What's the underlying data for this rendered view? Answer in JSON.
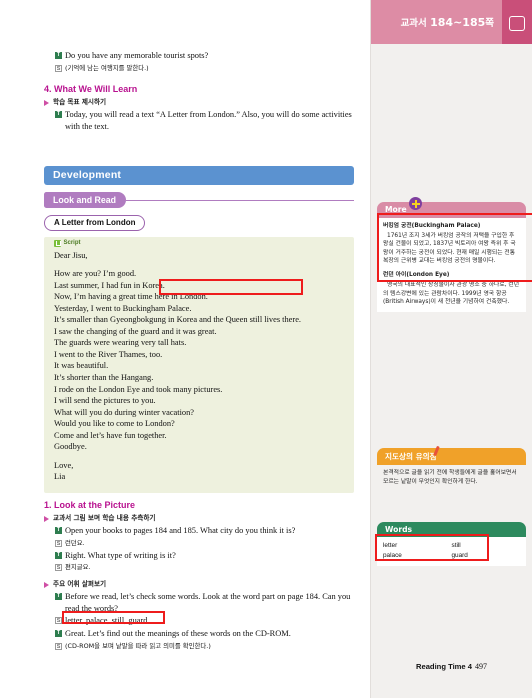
{
  "document": {
    "left_spine_color": "#f3eec4"
  },
  "main": {
    "intro_exchange": [
      {
        "speaker": "T",
        "text": "Do you have any memorable tourist spots?",
        "lang": "en"
      },
      {
        "speaker": "S",
        "text": "(기억에 남는 여행지를 말한다.)",
        "lang": "ko"
      }
    ],
    "section_4": {
      "heading": "4. What We Will Learn",
      "bullet": "학습 목표 제시하기",
      "exchange": [
        {
          "speaker": "T",
          "text": "Today, you will read a text “A Letter from London.” Also, you will do some activities with the text.",
          "lang": "en"
        }
      ]
    },
    "development_bar": "Development",
    "look_and_read": "Look and Read",
    "reading_title": "A Letter from London",
    "script_label": "Script",
    "letter": {
      "salutation": "Dear Jisu,",
      "body": [
        "How are you? I’m good.",
        "Last summer, I had fun in Korea.",
        "Now, I’m having a great time here in London.",
        "Yesterday, I went to Buckingham Palace.",
        "It’s smaller than Gyeongbokgung in Korea and the Queen still lives there.",
        "I saw the changing of the guard and it was great.",
        "The guards were wearing very tall hats.",
        "I went to the River Thames, too.",
        "It was beautiful.",
        "It’s shorter than the Hangang.",
        "I rode on the London Eye and took many pictures.",
        "I will send the pictures to you.",
        "What will you do during winter vacation?",
        "Would you like to come to London?",
        "Come and let’s have fun together.",
        "Goodbye."
      ],
      "closing": "Love,",
      "signature": "Lia"
    },
    "activity_1": {
      "heading": "1. Look at the Picture",
      "bullet_1": "교과서 그림 보며 학습 내용 추측하기",
      "exchange_1": [
        {
          "speaker": "T",
          "text": "Open your books to pages 184 and 185. What city do you think it is?",
          "lang": "en"
        },
        {
          "speaker": "S",
          "text": "런던요.",
          "lang": "ko"
        },
        {
          "speaker": "T",
          "text": "Right. What type of writing is it?",
          "lang": "en"
        },
        {
          "speaker": "S",
          "text": "편지글요.",
          "lang": "ko"
        }
      ],
      "bullet_2": "주요 어휘 살펴보기",
      "exchange_2": [
        {
          "speaker": "T",
          "text": "Before we read, let’s check some words. Look at the word part on page 184. Can you read the words?",
          "lang": "en"
        },
        {
          "speaker": "S",
          "text": "letter, palace, still, guard",
          "lang": "en"
        },
        {
          "speaker": "T",
          "text": "Great. Let’s find out the meanings of these words on the CD-ROM.",
          "lang": "en"
        },
        {
          "speaker": "S",
          "text": "(CD-ROM을 보며 낱말을 따라 읽고 의미를 확인한다.)",
          "lang": "ko"
        }
      ]
    }
  },
  "sidebar": {
    "header": {
      "prefix": "교과서",
      "pages": "184~185",
      "suffix": "쪽",
      "icon": "open-book-icon"
    },
    "more_panel": {
      "title": "More",
      "icon": "plus-circle-icon",
      "entries": [
        {
          "term": "버킹엄 궁전(Buckingham Palace)",
          "body": "1761년 조지 3세가 버킹엄 공작의 저택을 구입한 후 왕실 건물이 되었고, 1837년 빅토리아 여왕 즉위 후 국왕이 거주하는 궁전이 되었다. 현재 매일 시행되는 전통 복장의 근위병 교대는 버킹엄 궁전의 명물이다."
        },
        {
          "term": "런던 아이(London Eye)",
          "body": "영국의 대표적인 상징물이자 관광 명소 중 하나로, 런던의 템스강변에 있는 관람차이다. 1999년 영국 항공(British Airways)이 새 천년을 기념하여 건축했다."
        }
      ]
    },
    "note_panel": {
      "title": "지도상의 유의점",
      "icon": "pencil-icon",
      "body": "본격적으로 글을 읽기 전에 학생들에게 글을 훑어보면서 모르는 낱말이 무엇인지 확인하게 한다."
    },
    "words_panel": {
      "title": "Words",
      "columns": [
        [
          "letter",
          "palace"
        ],
        [
          "still",
          "guard"
        ]
      ]
    },
    "footer": {
      "reading_time": "Reading Time 4",
      "page_number": "497"
    }
  },
  "annotations": {
    "highlight_color": "#ee1c1c",
    "boxes": [
      {
        "name": "letter-sentence-highlight"
      },
      {
        "name": "buckingham-note-highlight"
      },
      {
        "name": "vocabulary-line-highlight"
      },
      {
        "name": "words-table-highlight"
      }
    ]
  }
}
